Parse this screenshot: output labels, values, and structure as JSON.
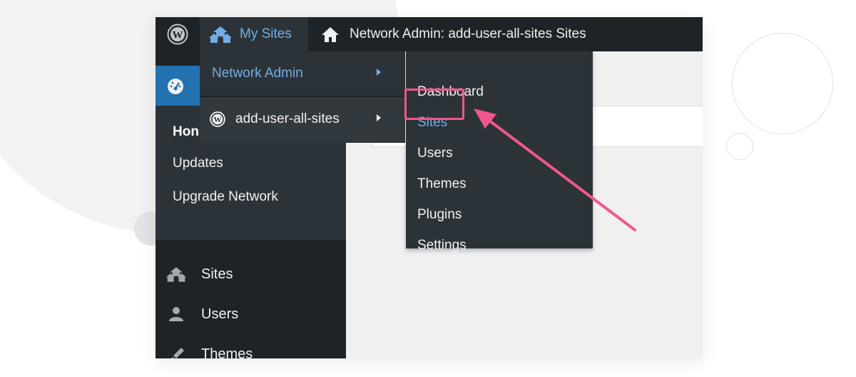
{
  "colors": {
    "adminbar_bg": "#1d2327",
    "submenu_bg": "#2c3338",
    "accent_blue": "#2271b1",
    "link_blue": "#72aee6",
    "highlight_pink": "#f0578d",
    "text_light": "#f0f0f1"
  },
  "adminbar": {
    "wp_logo_icon": "wordpress-logo-icon",
    "my_sites_icon": "multisite-houses-icon",
    "my_sites_label": "My Sites",
    "network_icon": "home-icon",
    "network_label": "Network Admin: add-user-all-sites Sites"
  },
  "my_sites_menu": {
    "items": [
      {
        "label": "Network Admin",
        "has_submenu": true
      },
      {
        "label": "add-user-all-sites",
        "icon": "wordpress-logo-icon",
        "has_submenu": true
      }
    ]
  },
  "network_admin_submenu": {
    "items": [
      {
        "label": "Dashboard"
      },
      {
        "label": "Sites",
        "highlighted": true
      },
      {
        "label": "Users"
      },
      {
        "label": "Themes"
      },
      {
        "label": "Plugins"
      },
      {
        "label": "Settings"
      }
    ]
  },
  "sidebar": {
    "dashboard_icon": "dashboard-gauge-icon",
    "dashboard_submenu": [
      {
        "label": "Hon",
        "current": true
      },
      {
        "label": "Updates"
      },
      {
        "label": "Upgrade Network"
      }
    ],
    "menu": [
      {
        "label": "Sites",
        "icon": "multisite-houses-icon"
      },
      {
        "label": "Users",
        "icon": "user-icon"
      },
      {
        "label": "Themes",
        "icon": "paintbrush-icon"
      }
    ]
  }
}
